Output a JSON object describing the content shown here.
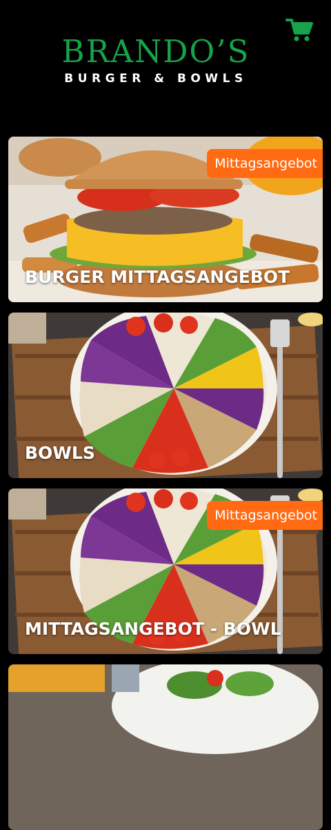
{
  "brand": {
    "name": "BRANDO’S",
    "tagline": "BURGER & BOWLS",
    "logo_color": "#17a34a"
  },
  "cart": {
    "icon": "shopping-cart-icon",
    "color": "#17a34a"
  },
  "badge_color": "#ff6a13",
  "categories": [
    {
      "title": "BURGER MITTAGSANGEBOT",
      "badge": "Mittagsangebot",
      "image": "burger-photo"
    },
    {
      "title": "BOWLS",
      "badge": "",
      "image": "bowl-photo"
    },
    {
      "title": "MITTAGSANGEBOT - BOWL",
      "badge": "Mittagsangebot",
      "image": "bowl-photo"
    },
    {
      "title": "",
      "badge": "",
      "image": "salad-photo"
    }
  ]
}
